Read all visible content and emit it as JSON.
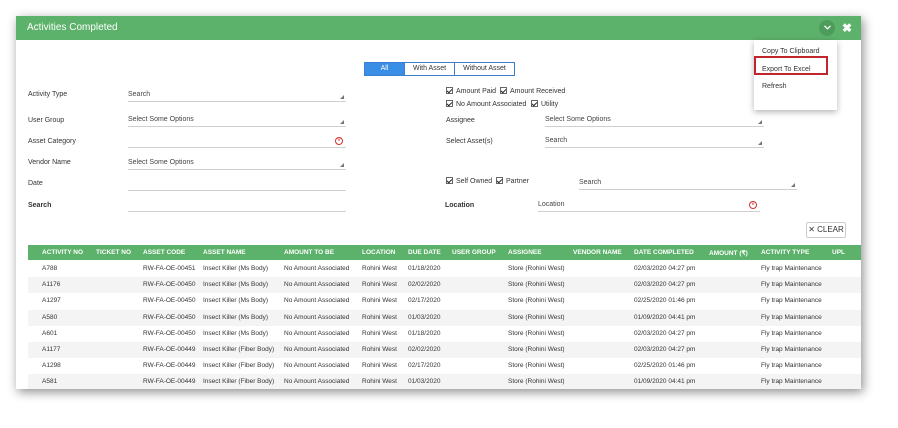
{
  "window": {
    "title": "Activities Completed",
    "chevron_icon": "chevron-down-icon",
    "close_label": "✖"
  },
  "menu": {
    "items": [
      "Copy To Clipboard",
      "Export To Excel",
      "Refresh"
    ]
  },
  "tabs": [
    "All",
    "With Asset",
    "Without Asset"
  ],
  "filters": {
    "activity_type": {
      "label": "Activity Type",
      "placeholder": "Search"
    },
    "user_group": {
      "label": "User Group",
      "placeholder": "Select Some Options"
    },
    "asset_category": {
      "label": "Asset Category",
      "value": ""
    },
    "vendor_name": {
      "label": "Vendor Name",
      "placeholder": "Select Some Options"
    },
    "date": {
      "label": "Date",
      "value": ""
    },
    "search": {
      "label": "Search",
      "value": ""
    },
    "amount_checks": [
      "Amount Paid",
      "Amount Received",
      "No Amount Associated",
      "Utility"
    ],
    "assignee": {
      "label": "Assignee",
      "placeholder": "Select Some Options"
    },
    "select_assets": {
      "label": "Select Asset(s)",
      "placeholder": "Search"
    },
    "ownership_checks": [
      "Self Owned",
      "Partner"
    ],
    "ownership_search": {
      "placeholder": "Search"
    },
    "location": {
      "label": "Location",
      "placeholder": "Location"
    },
    "clear_label": "✕ CLEAR"
  },
  "table": {
    "columns": [
      "ACTIVITY NO",
      "TICKET NO",
      "ASSET CODE",
      "ASSET NAME",
      "AMOUNT TO BE",
      "LOCATION",
      "DUE DATE",
      "USER GROUP",
      "ASSIGNEE",
      "VENDOR NAME",
      "DATE COMPLETED",
      "AMOUNT (₹)",
      "ACTIVITY TYPE",
      "UPL"
    ],
    "rows": [
      [
        "A788",
        "",
        "RW-FA-OE-00451",
        "Insect Killer (Ms Body)",
        "No Amount Associated",
        "Rohini West",
        "01/18/2020",
        "",
        "Store (Rohini West)",
        "",
        "02/03/2020 04:27 pm",
        "",
        "Fly trap Maintenance"
      ],
      [
        "A1176",
        "",
        "RW-FA-OE-00450",
        "Insect Killer (Ms Body)",
        "No Amount Associated",
        "Rohini West",
        "02/02/2020",
        "",
        "Store (Rohini West)",
        "",
        "02/03/2020 04:27 pm",
        "",
        "Fly trap Maintenance"
      ],
      [
        "A1297",
        "",
        "RW-FA-OE-00450",
        "Insect Killer (Ms Body)",
        "No Amount Associated",
        "Rohini West",
        "02/17/2020",
        "",
        "Store (Rohini West)",
        "",
        "02/25/2020 01:46 pm",
        "",
        "Fly trap Maintenance"
      ],
      [
        "A580",
        "",
        "RW-FA-OE-00450",
        "Insect Killer (Ms Body)",
        "No Amount Associated",
        "Rohini West",
        "01/03/2020",
        "",
        "Store (Rohini West)",
        "",
        "01/09/2020 04:41 pm",
        "",
        "Fly trap Maintenance"
      ],
      [
        "A601",
        "",
        "RW-FA-OE-00450",
        "Insect Killer (Ms Body)",
        "No Amount Associated",
        "Rohini West",
        "01/18/2020",
        "",
        "Store (Rohini West)",
        "",
        "02/03/2020 04:27 pm",
        "",
        "Fly trap Maintenance"
      ],
      [
        "A1177",
        "",
        "RW-FA-OE-00449",
        "Insect Killer (Fiber Body)",
        "No Amount Associated",
        "Rohini West",
        "02/02/2020",
        "",
        "Store (Rohini West)",
        "",
        "02/03/2020 04:27 pm",
        "",
        "Fly trap Maintenance"
      ],
      [
        "A1298",
        "",
        "RW-FA-OE-00449",
        "Insect Killer (Fiber Body)",
        "No Amount Associated",
        "Rohini West",
        "02/17/2020",
        "",
        "Store (Rohini West)",
        "",
        "02/25/2020 01:46 pm",
        "",
        "Fly trap Maintenance"
      ],
      [
        "A581",
        "",
        "RW-FA-OE-00449",
        "Insect Killer (Fiber Body)",
        "No Amount Associated",
        "Rohini West",
        "01/03/2020",
        "",
        "Store (Rohini West)",
        "",
        "01/09/2020 04:41 pm",
        "",
        "Fly trap Maintenance"
      ]
    ]
  },
  "colors": {
    "header_green": "#5cb26a",
    "tab_active_blue": "#3a8ee6",
    "highlight_red": "#c0272d"
  }
}
